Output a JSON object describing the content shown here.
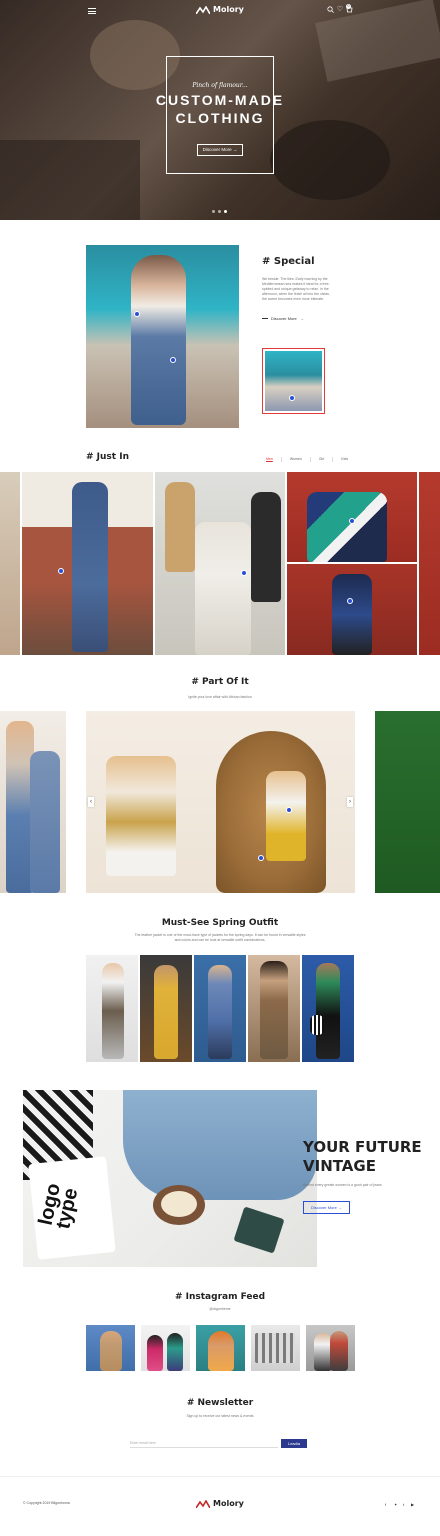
{
  "brand": {
    "name": "Molory",
    "accent": "#2a4fd6",
    "sale": "#e23b3b",
    "dark_button": "#2b3a8f"
  },
  "header": {
    "cart_count": "0"
  },
  "hero": {
    "subtitle": "Pinch of flamour...",
    "title_line1": "CUSTOM-MADE",
    "title_line2": "CLOTHING",
    "button": "Discover More",
    "slides": 3,
    "active_slide": 3
  },
  "special": {
    "title": "# Special",
    "text": "We beside. The tiles. Early morning by the Mediterranean sea makes it ideal for a free-spirited and unique getaway to relax. In the afternoon, when the finish all into the vistas, the scene becomes even more intimate.",
    "link": "Discover More"
  },
  "just_in": {
    "title": "# Just In",
    "tabs": [
      "Men",
      "Women",
      "Girl",
      "Kids"
    ],
    "active_tab": 0
  },
  "part_of_it": {
    "title": "# Part Of It",
    "subtitle": "Ignite your love affair with African fashion"
  },
  "spring": {
    "title": "Must-See Spring Outfit",
    "text": "The leather jacket is one of the must-have type of jackets for the spring days. It can be found in versatile styles and colors and can be look at versatile outfit combinations."
  },
  "vintage": {
    "title_line1": "YOUR FUTURE",
    "title_line2": "VINTAGE",
    "text": "Behind every greate women is a good pair of jeans",
    "button": "Discover More"
  },
  "instagram": {
    "title": "# Instagram Feed",
    "handle": "@drgoriheme"
  },
  "newsletter": {
    "title": "# Newsletter",
    "subtitle": "Sign up to receive our latest news & events",
    "placeholder": "Enter email here",
    "button": "Leadia"
  },
  "footer": {
    "copyright": "© Copyright 2019 Bllgonhoma",
    "social": [
      "f",
      "✦",
      "t",
      "▶"
    ]
  }
}
